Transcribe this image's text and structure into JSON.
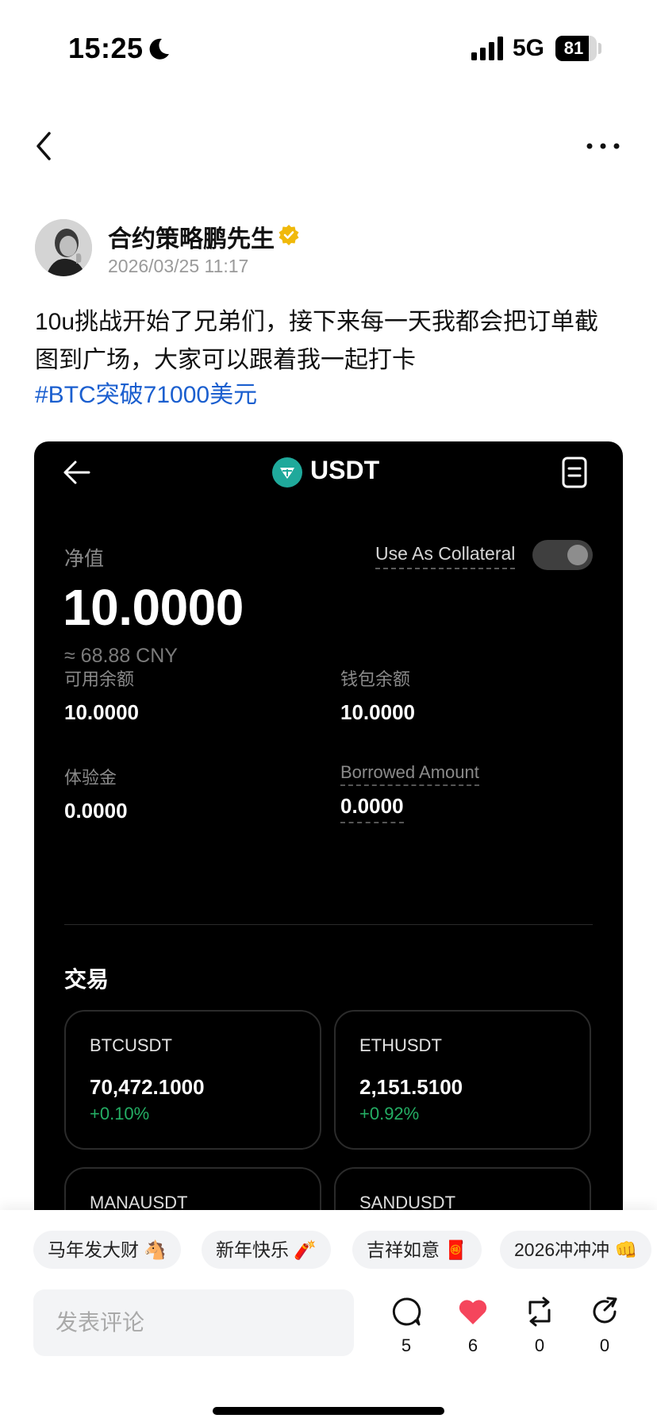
{
  "status_bar": {
    "time": "15:25",
    "network": "5G",
    "battery": "81",
    "battery_level": 0.81
  },
  "post": {
    "author": "合约策略鹏先生",
    "timestamp": "2026/03/25 11:17",
    "text": "10u挑战开始了兄弟们，接下来每一天我都会把订单截图到广场，大家可以跟着我一起打卡",
    "hashtag": "#BTC突破71000美元"
  },
  "screenshot": {
    "title": "USDT",
    "net_value_label": "净值",
    "collateral_label": "Use As Collateral",
    "collateral_enabled": false,
    "net_value": "10.0000",
    "net_value_cny": "≈ 68.88 CNY",
    "available_label": "可用余额",
    "available_value": "10.0000",
    "wallet_label": "钱包余额",
    "wallet_value": "10.0000",
    "bonus_label": "体验金",
    "bonus_value": "0.0000",
    "borrowed_label": "Borrowed Amount",
    "borrowed_value": "0.0000",
    "trade_title": "交易",
    "pairs": [
      {
        "symbol": "BTCUSDT",
        "price": "70,472.1000",
        "change": "+0.10%"
      },
      {
        "symbol": "ETHUSDT",
        "price": "2,151.5100",
        "change": "+0.92%"
      },
      {
        "symbol": "MANAUSDT",
        "price": "",
        "change": ""
      },
      {
        "symbol": "SANDUSDT",
        "price": "",
        "change": ""
      }
    ]
  },
  "chips": [
    "马年发大财 🐴",
    "新年快乐 🧨",
    "吉祥如意 🧧",
    "2026冲冲冲 👊"
  ],
  "comment": {
    "placeholder": "发表评论",
    "value": ""
  },
  "actions": {
    "comments": "5",
    "likes": "6",
    "reposts": "0",
    "shares": "0",
    "like_color": "#f5455c"
  }
}
